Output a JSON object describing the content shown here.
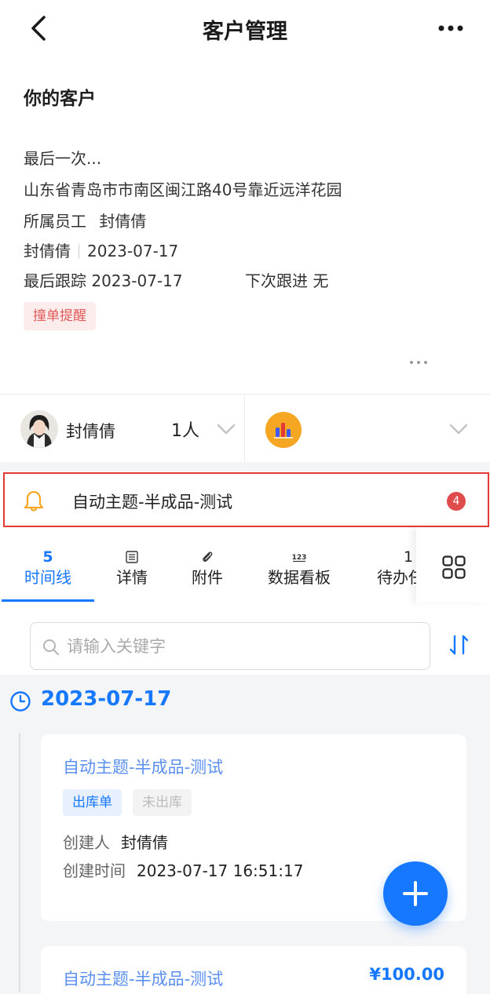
{
  "nav": {
    "title": "客户管理"
  },
  "customer": {
    "heading": "你的客户",
    "last_note": "最后一次...",
    "address": "山东省青岛市市南区闽江路40号靠近远洋花园",
    "owner_label": "所属员工",
    "owner_name": "封倩倩",
    "creator_name": "封倩倩",
    "create_date": "2023-07-17",
    "last_follow_label": "最后跟踪",
    "last_follow_date": "2023-07-17",
    "next_follow_label": "下次跟进",
    "next_follow_value": "无",
    "tag": "撞单提醒"
  },
  "owner_row": {
    "name": "封倩倩",
    "count": "1人"
  },
  "reminder": {
    "text": "自动主题-半成品-测试",
    "badge": "4"
  },
  "tabs": [
    {
      "count": "5",
      "label": "时间线",
      "active": true
    },
    {
      "icon": "list-icon",
      "label": "详情"
    },
    {
      "icon": "paperclip-icon",
      "label": "附件"
    },
    {
      "icon": "123-icon",
      "label": "数据看板"
    },
    {
      "count": "1",
      "label": "待办任务"
    }
  ],
  "search": {
    "placeholder": "请输入关键字"
  },
  "timeline": {
    "date": "2023-07-17",
    "cards": [
      {
        "title": "自动主题-半成品-测试",
        "tags": [
          "出库单",
          "未出库"
        ],
        "creator_label": "创建人",
        "creator": "封倩倩",
        "time_label": "创建时间",
        "time": "2023-07-17 16:51:17"
      },
      {
        "title": "自动主题-半成品-测试",
        "price": "¥100.00"
      }
    ]
  },
  "colors": {
    "accent": "#1677ff",
    "alert": "#e53935",
    "tag_red": "#e05a5a"
  }
}
